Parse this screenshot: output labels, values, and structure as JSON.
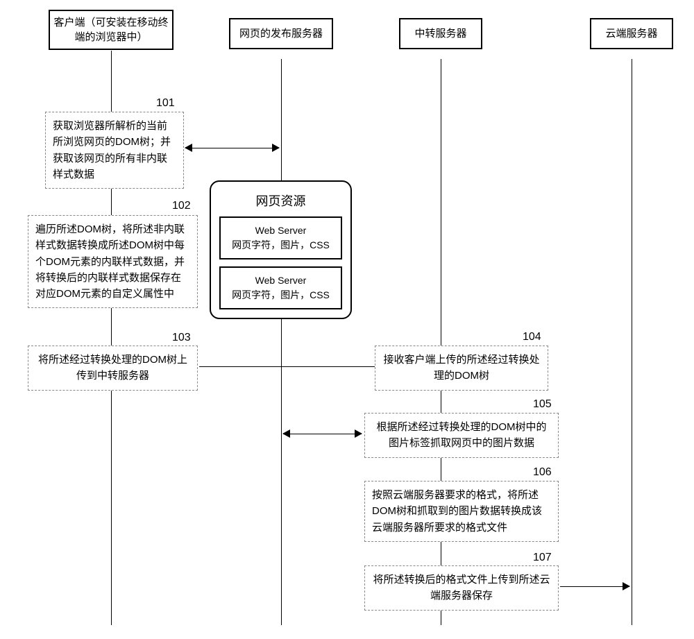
{
  "participants": {
    "client": "客户端（可安装在移动终端的浏览器中）",
    "publish": "网页的发布服务器",
    "relay": "中转服务器",
    "cloud": "云端服务器"
  },
  "steps": {
    "s101": {
      "label": "101",
      "text": "获取浏览器所解析的当前所浏览网页的DOM树；并获取该网页的所有非内联样式数据"
    },
    "s102": {
      "label": "102",
      "text": "遍历所述DOM树，将所述非内联样式数据转换成所述DOM树中每个DOM元素的内联样式数据，并将转换后的内联样式数据保存在对应DOM元素的自定义属性中"
    },
    "s103": {
      "label": "103",
      "text": "将所述经过转换处理的DOM树上传到中转服务器"
    },
    "s104": {
      "label": "104",
      "text": "接收客户端上传的所述经过转换处理的DOM树"
    },
    "s105": {
      "label": "105",
      "text": "根据所述经过转换处理的DOM树中的图片标签抓取网页中的图片数据"
    },
    "s106": {
      "label": "106",
      "text": "按照云端服务器要求的格式，将所述DOM树和抓取到的图片数据转换成该云端服务器所要求的格式文件"
    },
    "s107": {
      "label": "107",
      "text": "将所述转换后的格式文件上传到所述云端服务器保存"
    }
  },
  "resources": {
    "title": "网页资源",
    "server1": {
      "name": "Web Server",
      "desc": "网页字符，图片，CSS"
    },
    "server2": {
      "name": "Web Server",
      "desc": "网页字符，图片，CSS"
    }
  }
}
